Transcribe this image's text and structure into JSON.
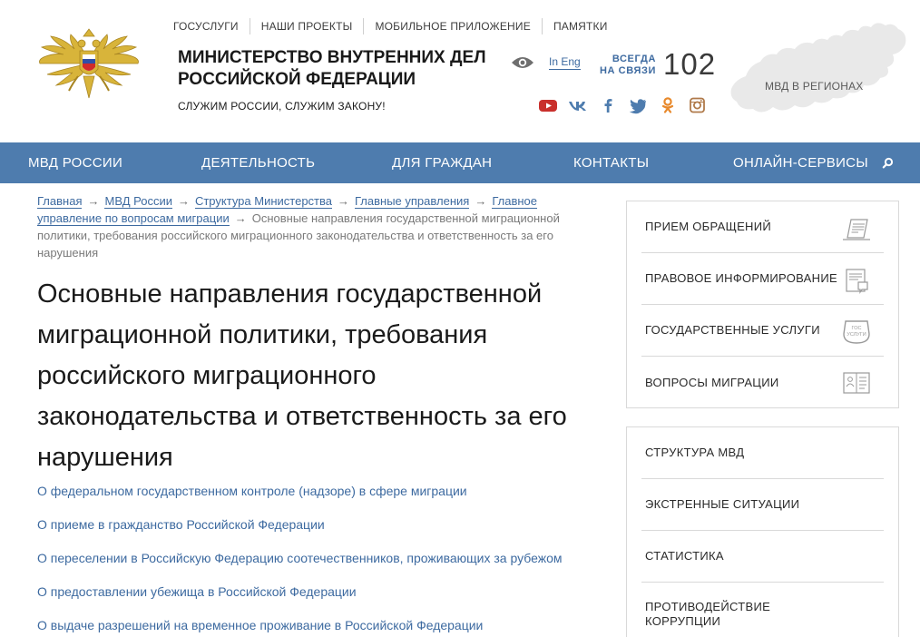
{
  "header": {
    "top_links": [
      "ГОСУСЛУГИ",
      "НАШИ ПРОЕКТЫ",
      "МОБИЛЬНОЕ ПРИЛОЖЕНИЕ",
      "ПАМЯТКИ"
    ],
    "title_line1": "МИНИСТЕРСТВО ВНУТРЕННИХ ДЕЛ",
    "title_line2": "РОССИЙСКОЙ ФЕДЕРАЦИИ",
    "motto": "СЛУЖИМ РОССИИ, СЛУЖИМ ЗАКОНУ!",
    "lang_link": "In Eng",
    "always_line1": "ВСЕГДА",
    "always_line2": "НА СВЯЗИ",
    "hotline": "102",
    "map_label": "МВД В РЕГИОНАХ",
    "social_icons": [
      "youtube-icon",
      "vk-icon",
      "facebook-icon",
      "twitter-icon",
      "odnoklassniki-icon",
      "instagram-icon"
    ]
  },
  "nav": {
    "items": [
      "МВД РОССИИ",
      "ДЕЯТЕЛЬНОСТЬ",
      "ДЛЯ ГРАЖДАН",
      "КОНТАКТЫ",
      "ОНЛАЙН-СЕРВИСЫ"
    ]
  },
  "breadcrumb": {
    "items": [
      "Главная",
      "МВД России",
      "Структура Министерства",
      "Главные управления"
    ],
    "item5_line1": "Главное",
    "item5_line2": "управление по вопросам миграции",
    "current": "Основные направления государственной миграционной политики, требования российского миграционного законодательства и ответственность за его нарушения"
  },
  "page": {
    "title_lines": [
      "Основные направления государственной",
      "миграционной политики, требования",
      "российского миграционного",
      "законодательства и ответственность за его",
      "нарушения"
    ],
    "links": [
      "О федеральном государственном контроле (надзоре) в сфере миграции",
      "О приеме в гражданство Российской Федерации",
      "О переселении в Российскую Федерацию соотечественников, проживающих за рубежом",
      "О предоставлении убежища в Российской Федерации",
      "О выдаче разрешений на временное проживание в Российской Федерации"
    ]
  },
  "sidebar": {
    "box1": [
      "ПРИЕМ ОБРАЩЕНИЙ",
      "ПРАВОВОЕ ИНФОРМИРОВАНИЕ",
      "ГОСУДАРСТВЕННЫЕ УСЛУГИ",
      "ВОПРОСЫ МИГРАЦИИ"
    ],
    "gos_icon_text_1": "ГОС",
    "gos_icon_text_2": "УСЛУГИ",
    "box2": [
      "СТРУКТУРА МВД",
      "ЭКСТРЕННЫЕ СИТУАЦИИ",
      "СТАТИСТИКА"
    ],
    "box2_last_line1": "ПРОТИВОДЕЙСТВИЕ",
    "box2_last_line2": "КОРРУПЦИИ"
  },
  "colors": {
    "nav_bg": "#4e7cae",
    "link": "#3d6aa0",
    "emblem_gold": "#d8b43a"
  }
}
